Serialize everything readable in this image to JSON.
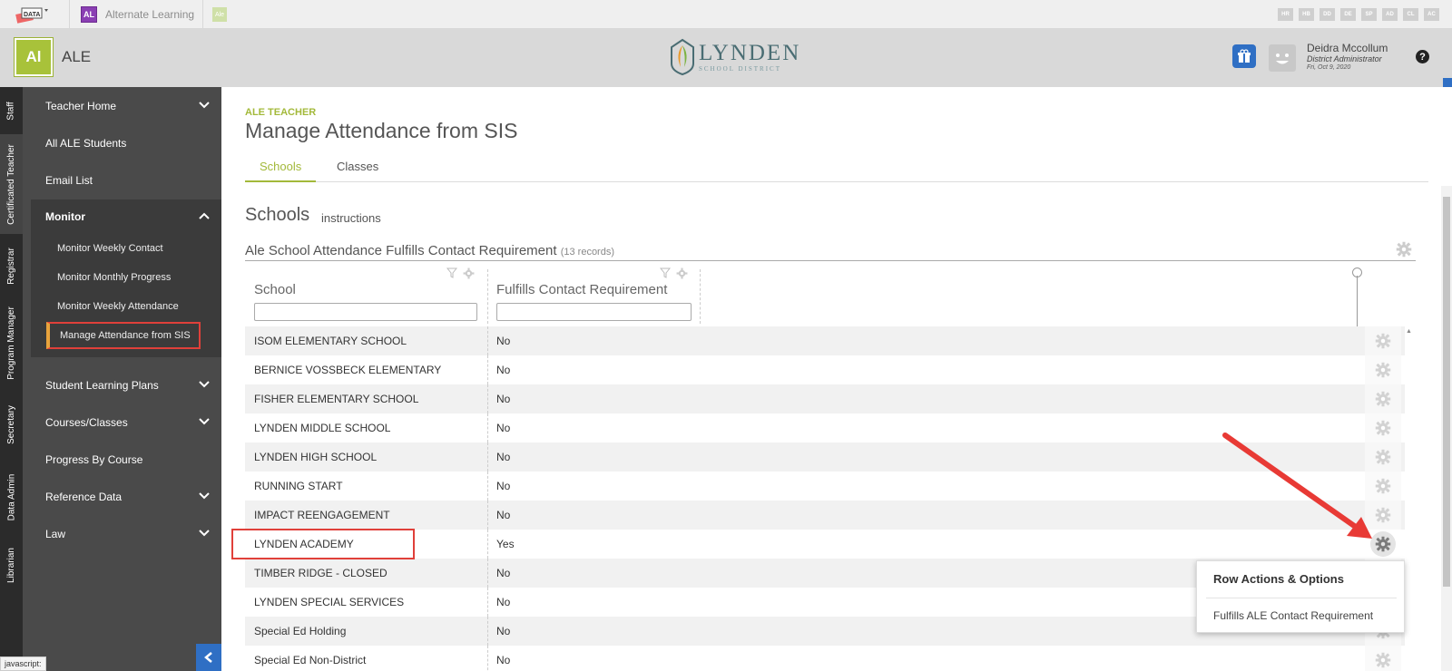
{
  "topbar": {
    "app_tab_badge": "AL",
    "app_tab_label": "Alternate Learning",
    "app_tab2_badge": "Ale",
    "modules": [
      "HR",
      "HB",
      "DD",
      "DE",
      "SP",
      "AD",
      "CL",
      "AC"
    ]
  },
  "header": {
    "logo_text": "Al",
    "app_name": "ALE",
    "district_name": "LYNDEN",
    "district_subtitle": "SCHOOL DISTRICT",
    "user_name": "Deidra Mccollum",
    "user_role": "District Administrator",
    "user_date": "Fri, Oct 9, 2020",
    "help": "?"
  },
  "roles": [
    "Staff",
    "Certificated Teacher",
    "Registrar",
    "Program Manager",
    "Secretary",
    "Data Admin",
    "Librarian"
  ],
  "sidebar": {
    "teacher_home": "Teacher Home",
    "all_students": "All ALE Students",
    "email_list": "Email List",
    "monitor": "Monitor",
    "monitor_items": [
      "Monitor Weekly Contact",
      "Monitor Monthly Progress",
      "Monitor Weekly Attendance",
      "Manage Attendance from SIS"
    ],
    "learning_plans": "Student Learning Plans",
    "courses": "Courses/Classes",
    "progress": "Progress By Course",
    "reference": "Reference Data",
    "law": "Law"
  },
  "status_bar": "javascript:",
  "page": {
    "crumb": "ALE TEACHER",
    "title": "Manage Attendance from SIS",
    "tabs": [
      "Schools",
      "Classes"
    ],
    "section_title": "Schools",
    "section_instructions": "instructions",
    "grid_title": "Ale School Attendance Fulfills Contact Requirement",
    "grid_count": "(13 records)"
  },
  "grid": {
    "columns": [
      "School",
      "Fulfills Contact Requirement"
    ],
    "rows": [
      [
        "ISOM ELEMENTARY SCHOOL",
        "No"
      ],
      [
        "BERNICE VOSSBECK ELEMENTARY",
        "No"
      ],
      [
        "FISHER ELEMENTARY SCHOOL",
        "No"
      ],
      [
        "LYNDEN MIDDLE SCHOOL",
        "No"
      ],
      [
        "LYNDEN HIGH SCHOOL",
        "No"
      ],
      [
        "RUNNING START",
        "No"
      ],
      [
        "IMPACT REENGAGEMENT",
        "No"
      ],
      [
        "LYNDEN ACADEMY",
        "Yes"
      ],
      [
        "TIMBER RIDGE - CLOSED",
        "No"
      ],
      [
        "LYNDEN SPECIAL SERVICES",
        "No"
      ],
      [
        "Special Ed Holding",
        "No"
      ],
      [
        "Special Ed Non-District",
        "No"
      ]
    ]
  },
  "popup": {
    "title": "Row Actions & Options",
    "option": "Fulfills ALE Contact Requirement"
  },
  "colors": {
    "accent": "#a3b93a",
    "highlight": "#e0403a",
    "brand_blue": "#2f6fc4"
  }
}
